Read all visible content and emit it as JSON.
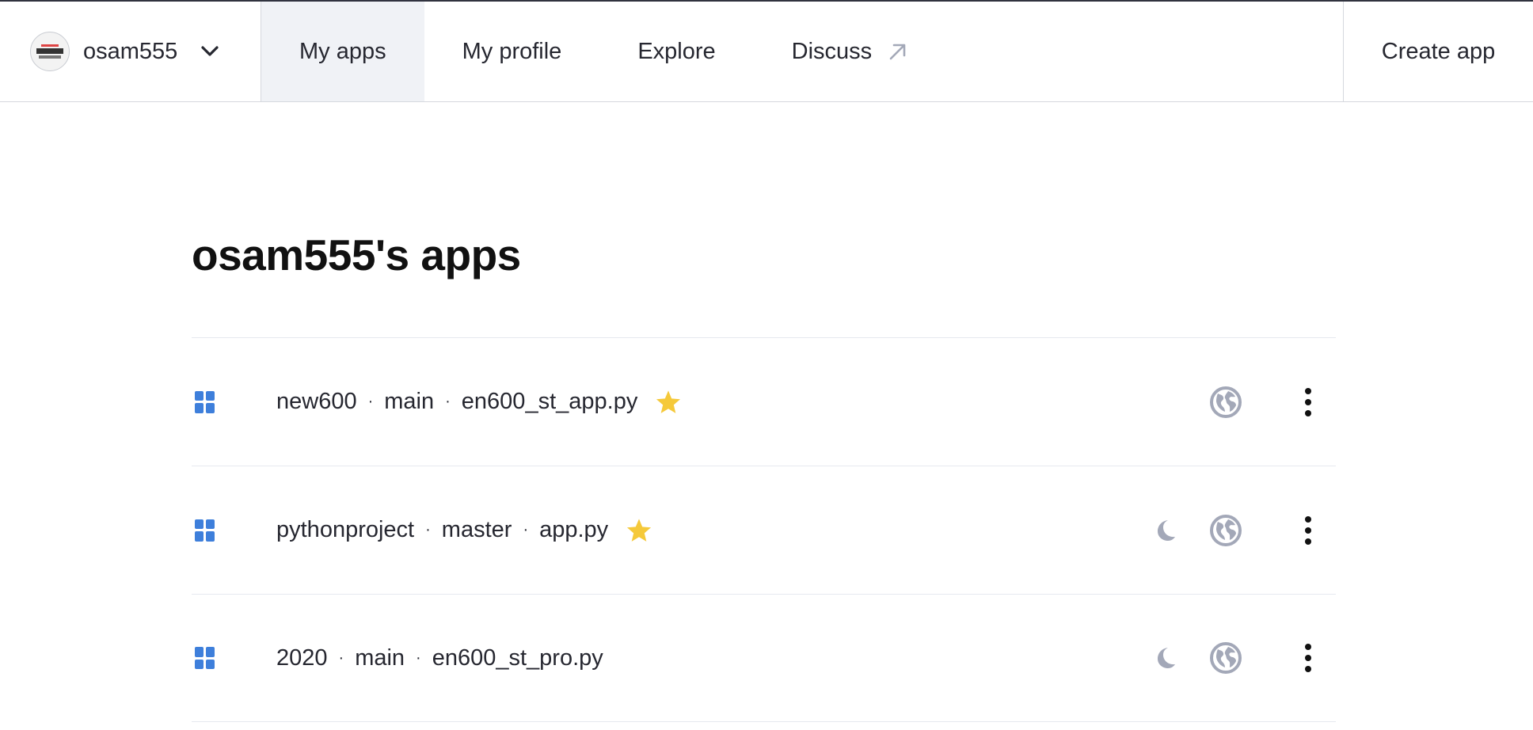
{
  "nav": {
    "user_name": "osam555",
    "tabs": [
      {
        "label": "My apps"
      },
      {
        "label": "My profile"
      },
      {
        "label": "Explore"
      },
      {
        "label": "Discuss"
      }
    ],
    "create_label": "Create app"
  },
  "page": {
    "title": "osam555's apps"
  },
  "apps": [
    {
      "repo": "new600",
      "branch": "main",
      "file": "en600_st_app.py",
      "starred": true,
      "sleeping": false
    },
    {
      "repo": "pythonproject",
      "branch": "master",
      "file": "app.py",
      "starred": true,
      "sleeping": true
    },
    {
      "repo": "2020",
      "branch": "main",
      "file": "en600_st_pro.py",
      "starred": false,
      "sleeping": true
    }
  ],
  "separator": "·",
  "icons": {
    "app": "dashboard-grid-icon",
    "star": "star-icon",
    "sleep": "moon-icon",
    "visibility": "globe-icon",
    "menu": "kebab-menu-icon",
    "dropdown": "chevron-down-icon",
    "external": "external-arrow-icon"
  },
  "colors": {
    "accent_blue": "#3e7fdb",
    "star_yellow": "#f5c93a",
    "muted_icon": "#a3a8b8",
    "active_tab_bg": "#f0f2f6"
  }
}
